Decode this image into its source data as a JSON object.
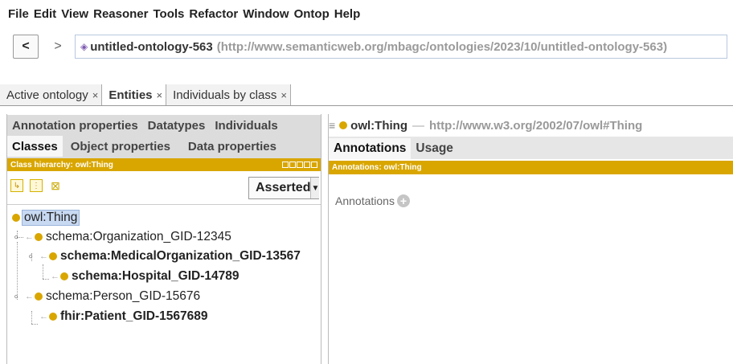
{
  "menu": [
    "File",
    "Edit",
    "View",
    "Reasoner",
    "Tools",
    "Refactor",
    "Window",
    "Ontop",
    "Help"
  ],
  "nav": {
    "back": "<",
    "forward": ">"
  },
  "address": {
    "name": "untitled-ontology-563",
    "iri": "(http://www.semanticweb.org/mbagc/ontologies/2023/10/untitled-ontology-563)"
  },
  "tabs": [
    {
      "label": "Active ontology",
      "close": "×"
    },
    {
      "label": "Entities",
      "close": "×"
    },
    {
      "label": "Individuals by class",
      "close": "×"
    }
  ],
  "left": {
    "subtabs_row1": [
      "Annotation properties",
      "Datatypes",
      "Individuals"
    ],
    "subtabs_row2": [
      "Classes",
      "Object properties",
      "Data properties"
    ],
    "hierarchy_label": "Class hierarchy: owl:Thing",
    "asserted": "Asserted",
    "tree": [
      "owl:Thing",
      "schema:Organization_GID-12345",
      "schema:MedicalOrganization_GID-13567",
      "schema:Hospital_GID-14789",
      "schema:Person_GID-15676",
      "fhir:Patient_GID-1567689"
    ]
  },
  "right": {
    "entity_name": "owl:Thing",
    "entity_sep": "—",
    "entity_uri": "http://www.w3.org/2002/07/owl#Thing",
    "tabs": [
      "Annotations",
      "Usage"
    ],
    "bar_label": "Annotations: owl:Thing",
    "annotations_label": "Annotations",
    "plus": "+"
  },
  "colors": {
    "accent": "#d9a600",
    "selection": "#c8d9f2"
  }
}
